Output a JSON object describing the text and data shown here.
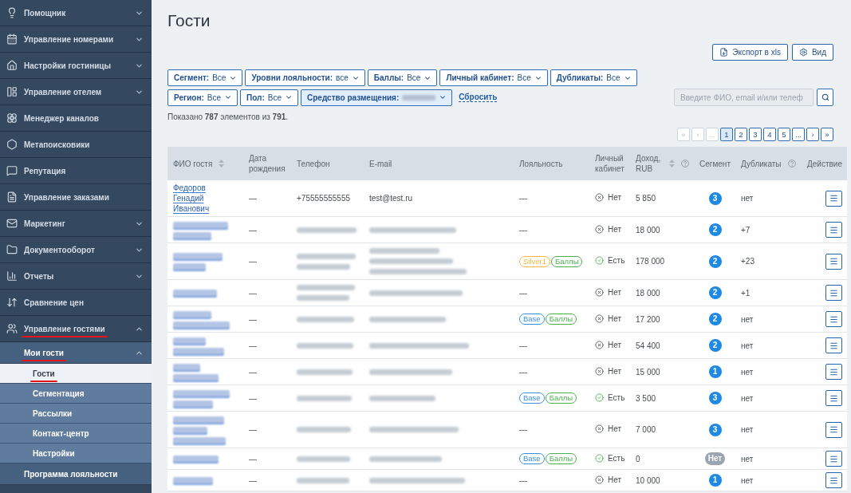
{
  "sidebar": {
    "items": [
      {
        "label": "Помощник",
        "expanded": false,
        "annotated": false
      },
      {
        "label": "Управление номерами",
        "expanded": false,
        "annotated": false
      },
      {
        "label": "Настройки гостиницы",
        "expanded": false,
        "annotated": false
      },
      {
        "label": "Управление отелем",
        "expanded": false,
        "annotated": false
      },
      {
        "label": "Менеджер каналов",
        "annotated": false
      },
      {
        "label": "Метапоисковики",
        "annotated": false
      },
      {
        "label": "Репутация",
        "annotated": false
      },
      {
        "label": "Управление заказами",
        "annotated": false
      },
      {
        "label": "Маркетинг",
        "expanded": false,
        "annotated": false
      },
      {
        "label": "Документооборот",
        "expanded": false,
        "annotated": false
      },
      {
        "label": "Отчеты",
        "expanded": false,
        "annotated": false
      },
      {
        "label": "Сравнение цен",
        "annotated": false
      },
      {
        "label": "Управление гостями",
        "expanded": true,
        "annotated": true,
        "children": [
          {
            "label": "Мои гости",
            "expanded": true,
            "annotated": true,
            "children": [
              {
                "label": "Гости",
                "selected": true,
                "annotated": true
              },
              {
                "label": "Сегментация",
                "selected": false,
                "annotated": false
              },
              {
                "label": "Рассылки",
                "selected": false,
                "annotated": false
              },
              {
                "label": "Контакт-центр",
                "selected": false,
                "annotated": false
              },
              {
                "label": "Настройки",
                "selected": false,
                "annotated": false
              }
            ]
          },
          {
            "label": "Программа лояльности",
            "annotated": false
          }
        ]
      }
    ]
  },
  "title": "Гости",
  "toolbar": [
    {
      "label": "Экспорт в xls"
    },
    {
      "label": "Вид"
    }
  ],
  "filter_rows": [
    [
      {
        "label": "Сегмент:",
        "value": "Все",
        "active": false,
        "blurred": false
      },
      {
        "label": "Уровни лояльности:",
        "value": "все",
        "active": false,
        "blurred": false
      },
      {
        "label": "Баллы:",
        "value": "Все",
        "active": false,
        "blurred": false
      },
      {
        "label": "Личный кабинет:",
        "value": "Все",
        "active": false,
        "blurred": false
      },
      {
        "label": "Дубликаты:",
        "value": "Все",
        "active": false,
        "blurred": false
      }
    ],
    [
      {
        "label": "Регион:",
        "value": "Все",
        "active": false,
        "blurred": false
      },
      {
        "label": "Пол:",
        "value": "Все",
        "active": false,
        "blurred": false
      },
      {
        "label": "Средство размещения:",
        "active": true,
        "blurred": true
      }
    ]
  ],
  "reset_link": "Сбросить",
  "search": {
    "placeholder": "Введите ФИО, email и/или телеф"
  },
  "summary": "Показано **787** элементов из **791**.",
  "pagination": [
    {
      "text": "«",
      "selected": false,
      "disabled": true
    },
    {
      "text": "‹",
      "selected": false,
      "disabled": true
    },
    {
      "text": "...",
      "selected": false,
      "disabled": true
    },
    {
      "text": "1",
      "selected": true,
      "disabled": false
    },
    {
      "text": "2",
      "selected": false,
      "disabled": false
    },
    {
      "text": "3",
      "selected": false,
      "disabled": false
    },
    {
      "text": "4",
      "selected": false,
      "disabled": false
    },
    {
      "text": "5",
      "selected": false,
      "disabled": false
    },
    {
      "text": "...",
      "selected": false,
      "disabled": false
    },
    {
      "text": "›",
      "selected": false,
      "disabled": false
    },
    {
      "text": "»",
      "selected": false,
      "disabled": false
    }
  ],
  "table": {
    "columns": [
      {
        "label": "ФИО гостя",
        "sortable": true,
        "help": false
      },
      {
        "label": "Дата рождения",
        "sortable": false,
        "help": false
      },
      {
        "label": "Телефон",
        "sortable": false,
        "help": false
      },
      {
        "label": "E-mail",
        "sortable": false,
        "help": false
      },
      {
        "label": "Лояльность",
        "sortable": false,
        "help": false
      },
      {
        "label": "Личный кабинет",
        "sortable": false,
        "help": false
      },
      {
        "label": "Доход, RUB",
        "sortable": true,
        "help": true
      },
      {
        "label": "Сегмент",
        "sortable": false,
        "help": false
      },
      {
        "label": "Дубликаты",
        "sortable": false,
        "help": true
      },
      {
        "label": "Действие",
        "sortable": false,
        "help": false
      }
    ],
    "rows": [
      {
        "guest_name": [
          {
            "blurred": false,
            "text": "Федоров Генадий Иванович"
          }
        ],
        "birth_date": "—",
        "phones": [
          {
            "blurred": false,
            "text": "+75555555555"
          }
        ],
        "emails": [
          {
            "blurred": false,
            "text": "test@test.ru"
          }
        ],
        "loyalty": [
          {
            "kind": "dash",
            "text": "—"
          }
        ],
        "cabinet": {
          "text": "Нет",
          "on": false
        },
        "income": "5 850",
        "segment": {
          "text": "3",
          "color": "#1e88e5"
        },
        "duplicates": "нет"
      },
      {
        "guest_name": [
          {
            "blurred": true
          },
          {
            "blurred": true
          }
        ],
        "birth_date": "—",
        "phones": [
          {
            "blurred": true
          }
        ],
        "emails": [
          {
            "blurred": true
          }
        ],
        "loyalty": [
          {
            "kind": "dash",
            "text": "—"
          }
        ],
        "cabinet": {
          "text": "Нет",
          "on": false
        },
        "income": "18 000",
        "segment": {
          "text": "2",
          "color": "#1e88e5"
        },
        "duplicates": "+7"
      },
      {
        "guest_name": [
          {
            "blurred": true
          },
          {
            "blurred": true
          }
        ],
        "birth_date": "—",
        "phones": [
          {
            "blurred": true
          },
          {
            "blurred": true
          }
        ],
        "emails": [
          {
            "blurred": true
          },
          {
            "blurred": true
          },
          {
            "blurred": true
          }
        ],
        "loyalty": [
          {
            "kind": "tag",
            "text": "Silver1",
            "color": "#f6b73c"
          },
          {
            "kind": "tag",
            "text": "Баллы",
            "color": "#4caf50"
          }
        ],
        "cabinet": {
          "text": "Есть",
          "on": true
        },
        "income": "178 000",
        "segment": {
          "text": "2",
          "color": "#1e88e5"
        },
        "duplicates": "+23"
      },
      {
        "guest_name": [
          {
            "blurred": true
          }
        ],
        "birth_date": "—",
        "phones": [
          {
            "blurred": true
          },
          {
            "blurred": true
          }
        ],
        "emails": [
          {
            "blurred": true
          }
        ],
        "loyalty": [
          {
            "kind": "dash",
            "text": "—"
          }
        ],
        "cabinet": {
          "text": "Нет",
          "on": false
        },
        "income": "18 000",
        "segment": {
          "text": "2",
          "color": "#1e88e5"
        },
        "duplicates": "+1"
      },
      {
        "guest_name": [
          {
            "blurred": true
          },
          {
            "blurred": true
          }
        ],
        "birth_date": "—",
        "phones": [
          {
            "blurred": true
          }
        ],
        "emails": [
          {
            "blurred": true
          }
        ],
        "loyalty": [
          {
            "kind": "tag",
            "text": "Base",
            "color": "#3b8fe3"
          },
          {
            "kind": "tag",
            "text": "Баллы",
            "color": "#4caf50"
          }
        ],
        "cabinet": {
          "text": "Нет",
          "on": false
        },
        "income": "17 200",
        "segment": {
          "text": "2",
          "color": "#1e88e5"
        },
        "duplicates": "нет"
      },
      {
        "guest_name": [
          {
            "blurred": true
          },
          {
            "blurred": true
          }
        ],
        "birth_date": "—",
        "phones": [
          {
            "blurred": true
          }
        ],
        "emails": [
          {
            "blurred": true
          }
        ],
        "loyalty": [
          {
            "kind": "dash",
            "text": "—"
          }
        ],
        "cabinet": {
          "text": "Нет",
          "on": false
        },
        "income": "54 400",
        "segment": {
          "text": "2",
          "color": "#1e88e5"
        },
        "duplicates": "нет"
      },
      {
        "guest_name": [
          {
            "blurred": true
          },
          {
            "blurred": true
          }
        ],
        "birth_date": "—",
        "phones": [
          {
            "blurred": true
          }
        ],
        "emails": [
          {
            "blurred": true
          }
        ],
        "loyalty": [
          {
            "kind": "dash",
            "text": "—"
          }
        ],
        "cabinet": {
          "text": "Нет",
          "on": false
        },
        "income": "15 000",
        "segment": {
          "text": "1",
          "color": "#1e88e5"
        },
        "duplicates": "нет"
      },
      {
        "guest_name": [
          {
            "blurred": true
          },
          {
            "blurred": true
          }
        ],
        "birth_date": "—",
        "phones": [
          {
            "blurred": true
          }
        ],
        "emails": [
          {
            "blurred": true
          }
        ],
        "loyalty": [
          {
            "kind": "tag",
            "text": "Base",
            "color": "#3b8fe3"
          },
          {
            "kind": "tag",
            "text": "Баллы",
            "color": "#4caf50"
          }
        ],
        "cabinet": {
          "text": "Есть",
          "on": true
        },
        "income": "3 500",
        "segment": {
          "text": "3",
          "color": "#1e88e5"
        },
        "duplicates": "нет"
      },
      {
        "guest_name": [
          {
            "blurred": true
          },
          {
            "blurred": true
          },
          {
            "blurred": true
          }
        ],
        "birth_date": "—",
        "phones": [
          {
            "blurred": true
          }
        ],
        "emails": [
          {
            "blurred": true
          }
        ],
        "loyalty": [
          {
            "kind": "dash",
            "text": "—"
          }
        ],
        "cabinet": {
          "text": "Нет",
          "on": false
        },
        "income": "7 000",
        "segment": {
          "text": "3",
          "color": "#1e88e5"
        },
        "duplicates": "нет"
      },
      {
        "guest_name": [
          {
            "blurred": true
          }
        ],
        "birth_date": "—",
        "phones": [
          {
            "blurred": true
          }
        ],
        "emails": [
          {
            "blurred": true
          }
        ],
        "loyalty": [
          {
            "kind": "tag",
            "text": "Base",
            "color": "#3b8fe3"
          },
          {
            "kind": "tag",
            "text": "Баллы",
            "color": "#4caf50"
          }
        ],
        "cabinet": {
          "text": "Есть",
          "on": true
        },
        "income": "0",
        "segment": {
          "text": "Нет",
          "color": "#9aa5b1"
        },
        "duplicates": "нет"
      },
      {
        "guest_name": [
          {
            "blurred": true
          }
        ],
        "birth_date": "—",
        "phones": [
          {
            "blurred": true
          }
        ],
        "emails": [
          {
            "blurred": true
          }
        ],
        "loyalty": [
          {
            "kind": "dash",
            "text": "—"
          }
        ],
        "cabinet": {
          "text": "Нет",
          "on": false
        },
        "income": "10 000",
        "segment": {
          "text": "1",
          "color": "#1e88e5"
        },
        "duplicates": "нет"
      }
    ]
  }
}
